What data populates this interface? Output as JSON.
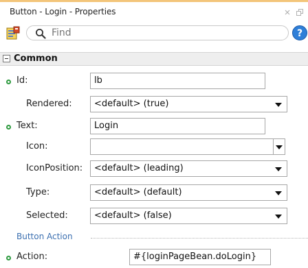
{
  "window": {
    "title": "Button - Login - Properties"
  },
  "toolbar": {
    "search_placeholder": "Find"
  },
  "section": {
    "title": "Common"
  },
  "properties": {
    "id": {
      "label": "Id:",
      "value": "lb"
    },
    "rendered": {
      "label": "Rendered:",
      "value": "<default> (true)"
    },
    "text": {
      "label": "Text:",
      "value": "Login"
    },
    "icon": {
      "label": "Icon:",
      "value": ""
    },
    "icon_position": {
      "label": "IconPosition:",
      "value": "<default> (leading)"
    },
    "type": {
      "label": "Type:",
      "value": "<default> (default)"
    },
    "selected": {
      "label": "Selected:",
      "value": "<default> (false)"
    }
  },
  "button_action": {
    "title": "Button Action",
    "action": {
      "label": "Action:",
      "value": "#{loginPageBean.doLogin}"
    }
  },
  "colors": {
    "required_marker": "#2e9a3f",
    "group_title": "#3b6fb0",
    "accent": "#f3c57a"
  }
}
